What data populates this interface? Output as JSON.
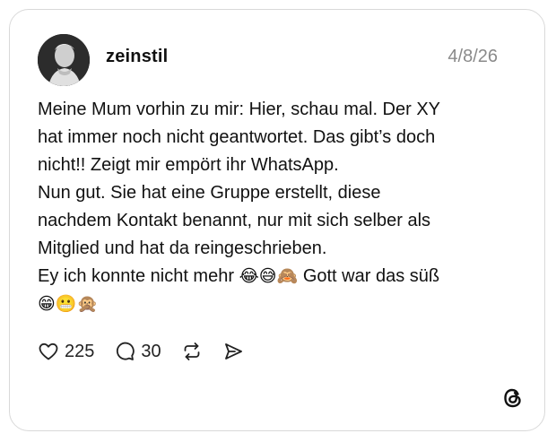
{
  "post": {
    "username": "zeinstil",
    "date": "4/8/26",
    "lines": [
      "Meine Mum vorhin zu mir: Hier, schau mal. Der XY",
      "hat immer noch nicht geantwortet. Das gibt’s doch",
      "nicht!! Zeigt mir empört ihr WhatsApp.",
      "Nun gut. Sie hat eine Gruppe erstellt, diese",
      "nachdem Kontakt benannt, nur mit sich selber als",
      "Mitglied und hat da reingeschrieben.",
      "Ey ich konnte nicht mehr",
      "Gott war das süß"
    ],
    "emojis_line7": [
      "😂",
      "😅",
      "🙈"
    ],
    "emojis_line8": [
      "😁",
      "😬",
      "🙊"
    ]
  },
  "actions": {
    "likes": "225",
    "replies": "30"
  },
  "icons": {
    "like": "heart-icon",
    "reply": "speech-bubble-icon",
    "repost": "repost-icon",
    "share": "send-icon",
    "brand": "threads-logo-icon"
  },
  "colors": {
    "text": "#111111",
    "muted": "#8a8a8a",
    "border": "#d9d9d9"
  }
}
